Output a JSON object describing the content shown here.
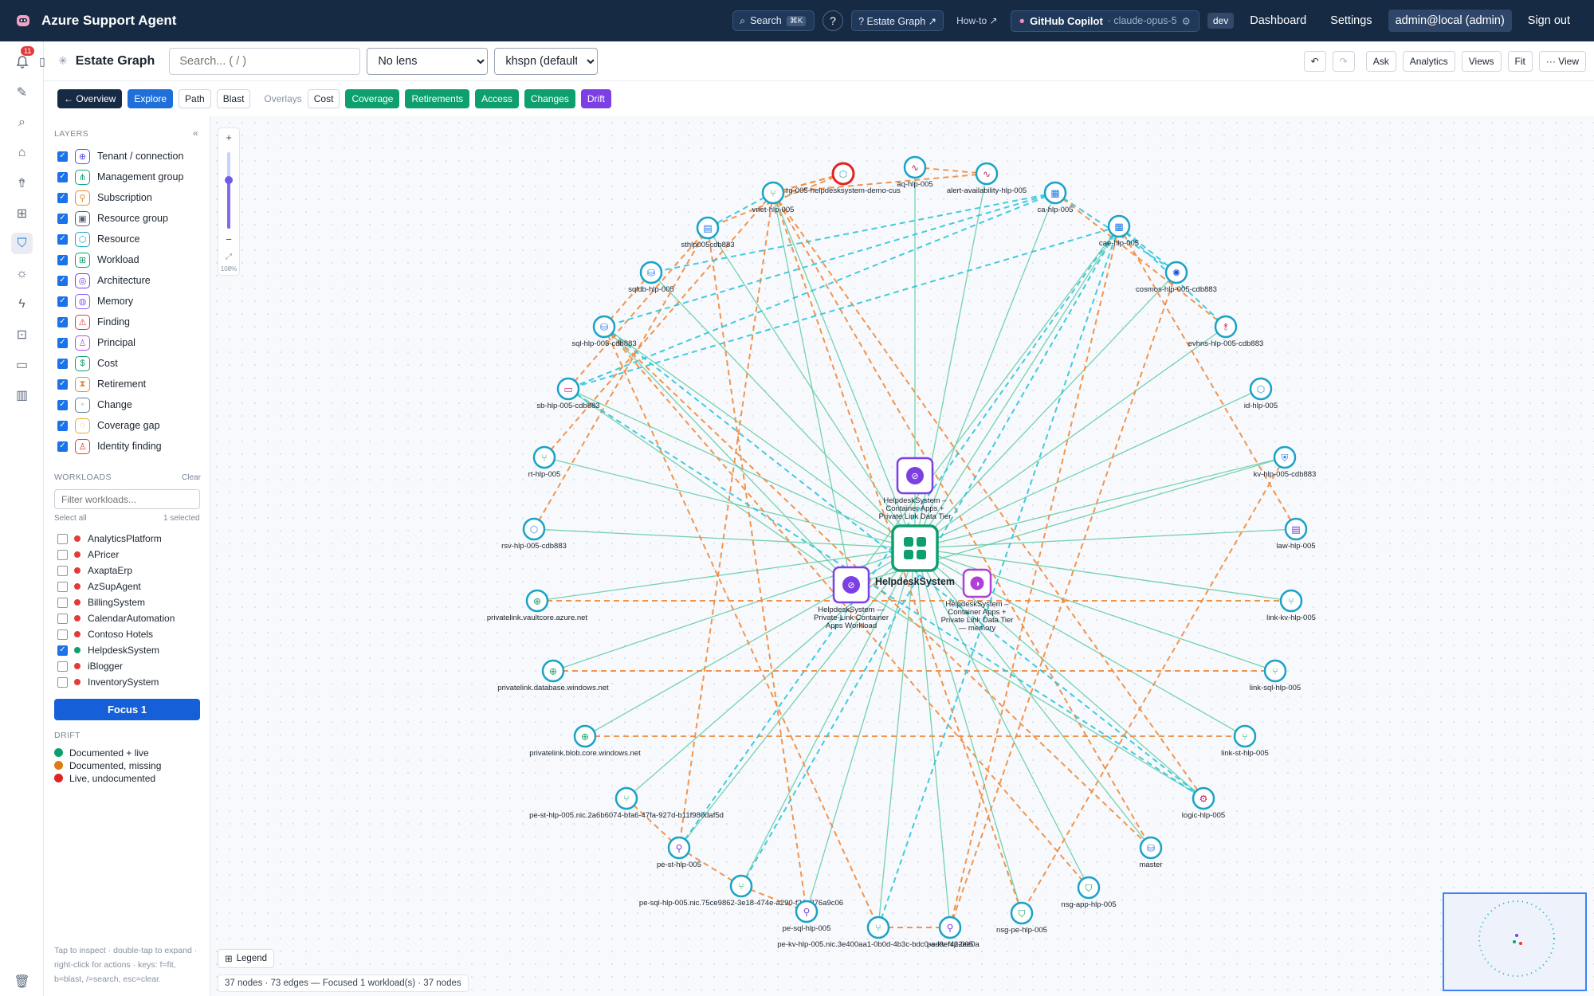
{
  "topbar": {
    "title": "Azure Support Agent",
    "search_label": "Search",
    "search_kbd": "⌘K",
    "help_label": "?",
    "estate_graph_label": "? Estate Graph ↗",
    "howto_label": "How-to ↗",
    "copilot_label": "GitHub Copilot",
    "copilot_model": "· claude-opus-5",
    "env": "dev",
    "links": [
      "Dashboard",
      "Settings"
    ],
    "user": "admin@local (admin)",
    "signout": "Sign out"
  },
  "rail": {
    "badge": "11"
  },
  "toolbar": {
    "title": "Estate Graph",
    "search_placeholder": "Search... ( / )",
    "lens_value": "No lens",
    "layout_value": "khspn (default)",
    "actions": [
      "Ask",
      "Analytics",
      "Views",
      "Fit",
      "··· View"
    ]
  },
  "modebar": {
    "buttons": [
      "← Overview",
      "Explore",
      "Path",
      "Blast"
    ],
    "overlays_label": "Overlays",
    "overlays": [
      "Cost",
      "Coverage",
      "Retirements",
      "Access",
      "Changes",
      "Drift"
    ]
  },
  "layers": {
    "heading": "LAYERS",
    "collapse": "«",
    "items": [
      {
        "label": "Tenant / connection",
        "color": "#5b4fe8",
        "glyph": "⊕"
      },
      {
        "label": "Management group",
        "color": "#10a37f",
        "glyph": "⋔"
      },
      {
        "label": "Subscription",
        "color": "#e8892f",
        "glyph": "⚲"
      },
      {
        "label": "Resource group",
        "color": "#555f6e",
        "glyph": "▣"
      },
      {
        "label": "Resource",
        "color": "#1aa3c8",
        "glyph": "⬡"
      },
      {
        "label": "Workload",
        "color": "#0e9f6e",
        "glyph": "⊞"
      },
      {
        "label": "Architecture",
        "color": "#7b3fe4",
        "glyph": "◎"
      },
      {
        "label": "Memory",
        "color": "#8b5cf6",
        "glyph": "◍"
      },
      {
        "label": "Finding",
        "color": "#e23b3b",
        "glyph": "⚠"
      },
      {
        "label": "Principal",
        "color": "#b14ee0",
        "glyph": "♙"
      },
      {
        "label": "Cost",
        "color": "#0e9f6e",
        "glyph": "$"
      },
      {
        "label": "Retirement",
        "color": "#e8892f",
        "glyph": "⧗"
      },
      {
        "label": "Change",
        "color": "#5a7ea8",
        "glyph": "◦"
      },
      {
        "label": "Coverage gap",
        "color": "#e8a82f",
        "glyph": "◌"
      },
      {
        "label": "Identity finding",
        "color": "#e23b3b",
        "glyph": "♙"
      }
    ]
  },
  "workloads": {
    "heading": "WORKLOADS",
    "clear": "Clear",
    "filter_placeholder": "Filter workloads...",
    "select_all": "Select all",
    "selected": "1 selected",
    "items": [
      {
        "label": "AnalyticsPlatform",
        "checked": false,
        "color": "#e23b3b"
      },
      {
        "label": "APricer",
        "checked": false,
        "color": "#e23b3b"
      },
      {
        "label": "AxaptaErp",
        "checked": false,
        "color": "#e23b3b"
      },
      {
        "label": "AzSupAgent",
        "checked": false,
        "color": "#e23b3b"
      },
      {
        "label": "BillingSystem",
        "checked": false,
        "color": "#e23b3b"
      },
      {
        "label": "CalendarAutomation",
        "checked": false,
        "color": "#e23b3b"
      },
      {
        "label": "Contoso Hotels",
        "checked": false,
        "color": "#e23b3b"
      },
      {
        "label": "HelpdeskSystem",
        "checked": true,
        "color": "#0e9f6e"
      },
      {
        "label": "iBlogger",
        "checked": false,
        "color": "#e23b3b"
      },
      {
        "label": "InventorySystem",
        "checked": false,
        "color": "#e23b3b"
      }
    ],
    "focus_button": "Focus 1"
  },
  "drift": {
    "heading": "DRIFT",
    "items": [
      {
        "label": "Documented + live",
        "color": "#0e9f6e"
      },
      {
        "label": "Documented, missing",
        "color": "#e07b12"
      },
      {
        "label": "Live, undocumented",
        "color": "#e02424"
      }
    ]
  },
  "hint": "Tap to inspect · double-tap to expand · right-click for actions · keys: f=fit, b=blast, /=search, esc=clear.",
  "canvas": {
    "zoom": "108%",
    "legend": "Legend",
    "status": "37 nodes · 73 edges — Focused 1 workload(s) · 37 nodes"
  },
  "graph": {
    "center": {
      "label": "HelpdeskSystem"
    },
    "arch_nodes": [
      {
        "id": "a1",
        "label": [
          "HelpdeskSystem –",
          "Container Apps +",
          "Private Link Data Tier"
        ]
      },
      {
        "id": "a2",
        "label": [
          "HelpdeskSystem —",
          "Private-Link Container",
          "Apps Workload"
        ]
      },
      {
        "id": "a3",
        "label": [
          "HelpdeskSystem –",
          "Container Apps +",
          "Private Link Data Tier",
          "— memory"
        ]
      }
    ],
    "nodes": [
      {
        "id": "rg",
        "label": "rg-005-helpdesksystem-demo-cus",
        "kind": "rg"
      },
      {
        "id": "aq",
        "label": "aq-hlp-005",
        "kind": "metric"
      },
      {
        "id": "alert",
        "label": "alert-availability-hlp-005",
        "kind": "metric"
      },
      {
        "id": "vnet",
        "label": "vnet-hlp-005",
        "kind": "net"
      },
      {
        "id": "ca",
        "label": "ca-hlp-005",
        "kind": "grid"
      },
      {
        "id": "cae",
        "label": "cae-hlp-005",
        "kind": "grid"
      },
      {
        "id": "sthlp",
        "label": "sthlp005cdb883",
        "kind": "storage"
      },
      {
        "id": "cosmos",
        "label": "cosmos-hlp-005-cdb883",
        "kind": "cosmos"
      },
      {
        "id": "sqldb",
        "label": "sqldb-hlp-005",
        "kind": "db"
      },
      {
        "id": "evhns",
        "label": "evhns-hlp-005-cdb883",
        "kind": "evh"
      },
      {
        "id": "sql",
        "label": "sql-hlp-005-cdb883",
        "kind": "db"
      },
      {
        "id": "id",
        "label": "id-hlp-005",
        "kind": "cube"
      },
      {
        "id": "sb",
        "label": "sb-hlp-005-cdb883",
        "kind": "sb"
      },
      {
        "id": "kv",
        "label": "kv-hlp-005-cdb883",
        "kind": "kv"
      },
      {
        "id": "rt",
        "label": "rt-hlp-005",
        "kind": "net"
      },
      {
        "id": "law",
        "label": "law-hlp-005",
        "kind": "law"
      },
      {
        "id": "rsv",
        "label": "rsv-hlp-005-cdb883",
        "kind": "cube"
      },
      {
        "id": "plvault",
        "label": "privatelink.vaultcore.azure.net",
        "kind": "dns"
      },
      {
        "id": "linkkv",
        "label": "link-kv-hlp-005",
        "kind": "net"
      },
      {
        "id": "pldb",
        "label": "privatelink.database.windows.net",
        "kind": "dns"
      },
      {
        "id": "linksql",
        "label": "link-sql-hlp-005",
        "kind": "net"
      },
      {
        "id": "plblob",
        "label": "privatelink.blob.core.windows.net",
        "kind": "dns"
      },
      {
        "id": "linkst",
        "label": "link-st-hlp-005",
        "kind": "net"
      },
      {
        "id": "pestnic",
        "label": "pe-st-hlp-005.nic.2a6b6074-bfa6-47fa-927d-b11f980daf5d",
        "kind": "net"
      },
      {
        "id": "logic",
        "label": "logic-hlp-005",
        "kind": "logic"
      },
      {
        "id": "pest",
        "label": "pe-st-hlp-005",
        "kind": "pe"
      },
      {
        "id": "master",
        "label": "master",
        "kind": "db"
      },
      {
        "id": "pesqlnic",
        "label": "pe-sql-hlp-005.nic.75ce9862-3e18-474e-a290-f24e376a9c06",
        "kind": "net"
      },
      {
        "id": "nsgapp",
        "label": "nsg-app-hlp-005",
        "kind": "nsg"
      },
      {
        "id": "pesql",
        "label": "pe-sql-hlp-005",
        "kind": "pe"
      },
      {
        "id": "nsgpe",
        "label": "nsg-pe-hlp-005",
        "kind": "nsg"
      },
      {
        "id": "pekvnic",
        "label": "pe-kv-hlp-005.nic.3e400aa1-0b0d-4b3c-bdc0-ad9ef422ee0a",
        "kind": "net"
      },
      {
        "id": "pekv",
        "label": "pe-kv-hlp-005",
        "kind": "pe"
      }
    ]
  }
}
